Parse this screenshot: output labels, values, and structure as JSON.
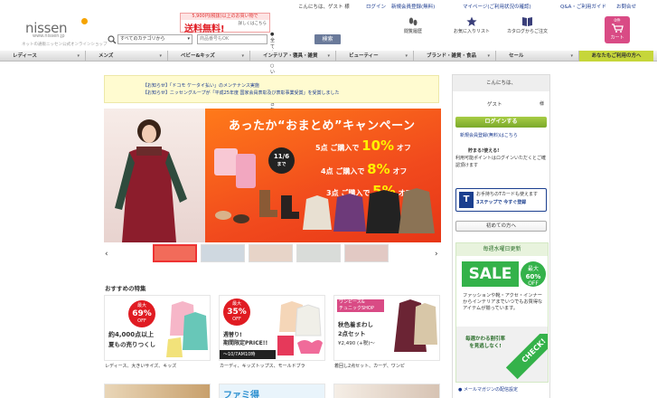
{
  "header": {
    "logo_text": "nissen",
    "logo_domain": "www.nissen.jp",
    "logo_tagline": "ネットの通販ニッセン公式オンラインショップ",
    "greeting": "こんにちは、ゲスト 様",
    "login_link": "ログイン",
    "register_link": "新規会員登録(無料)",
    "mypage_link": "マイページ(ご利用状況の確認)",
    "qa_link": "Q&A・ご利用ガイド",
    "contact_link": "お問合せ",
    "shipping": {
      "top": "5,900円(税抜)以上のお買い物で",
      "main": "送料無料!",
      "side": "詳しくはこちら"
    },
    "search": {
      "category_value": "すべてのカテゴリから",
      "keyword_placeholder": "商品番号もOK",
      "radio_all": "全て含む",
      "radio_any": "いずれかを含む",
      "button": "検索"
    },
    "icons": [
      {
        "label": "閲覧履歴",
        "icon": "footprints-icon"
      },
      {
        "label": "お気に入りリスト",
        "icon": "star-icon"
      },
      {
        "label": "カタログからご注文",
        "icon": "catalog-icon"
      }
    ],
    "cart_label": "カート",
    "cart_count": "0件"
  },
  "nav": {
    "items": [
      "レディース",
      "メンズ",
      "ベビー&キッズ",
      "インテリア・寝具・雑貨",
      "ビューティー",
      "ブランド・雑貨・食品",
      "セール"
    ],
    "beginner": "あなたもご利用の方へ"
  },
  "notice": {
    "line1": "【お知らせ】「ドコモ ケータイ払い」のメンテナンス実施",
    "line2": "【お知らせ】ニッセングループが「平成25年度 国家会員表彰及び表彰事業受賞」を受賞しました"
  },
  "hero": {
    "title": "あったか“おまとめ”キャンペーン",
    "offers": [
      {
        "count": "5点",
        "pre": "ご購入で",
        "pct": "10%",
        "post": "オフ"
      },
      {
        "count": "4点",
        "pre": "ご購入で",
        "pct": "8%",
        "post": "オフ"
      },
      {
        "count": "3点",
        "pre": "ご購入で",
        "pct": "5%",
        "post": "オフ"
      }
    ],
    "date": "11/6",
    "date_sub": "まで"
  },
  "recommend": {
    "heading": "おすすめの特集",
    "cards": [
      {
        "badge_top": "最大",
        "badge_pct": "69%",
        "badge_off": "OFF",
        "text1": "約4,000点以上",
        "text2": "夏もの売りつくし",
        "caption": "レディース、大きいサイズ、キッズ"
      },
      {
        "badge_top": "最大",
        "badge_pct": "35%",
        "badge_off": "OFF",
        "text1": "週替り!",
        "text2": "期間限定PRICE!!",
        "text3": "〜10/7AM10時",
        "caption": "カーディ、キッズトップス、モールドブラ"
      },
      {
        "badge_top": "ワンピース&",
        "badge_pct": "チュニックSHOP",
        "badge_off": "",
        "text1": "秋色着まわし",
        "text2": "2点セット",
        "text3": "¥2,490 (+税)〜",
        "caption": "着回し2点セット、カーデ、ワンピ"
      }
    ],
    "bottom_card2": "ファミ得"
  },
  "sidebar": {
    "greeting": "こんにちは、",
    "guest": "ゲスト",
    "sama": "様",
    "login_button": "ログインする",
    "register": "新規会員登録(無料)はこちら",
    "points_title": "貯まる!使える!",
    "points_body": "利用可能ポイントはログインいただくとご確認頂けます",
    "tpoint_line1": "お手持ちのTカードも使えます",
    "tpoint_line2": "3ステップで 今すぐ登録",
    "beginner": "初めての方へ",
    "weekly": "毎週水曜日更新",
    "sale": "SALE",
    "sale_off_pct": "60%",
    "sale_off_label": "OFF",
    "sale_off_top": "最大",
    "sale_desc": "ファッションや靴・アクセ・インナーからインテリアまでいつでもお買得なアイテムが揃っています。",
    "sale_bottom": "毎週かわる割引率を見逃しなく!",
    "check": "CHECK!",
    "mailmag": "メールマガジンの配信設定"
  }
}
